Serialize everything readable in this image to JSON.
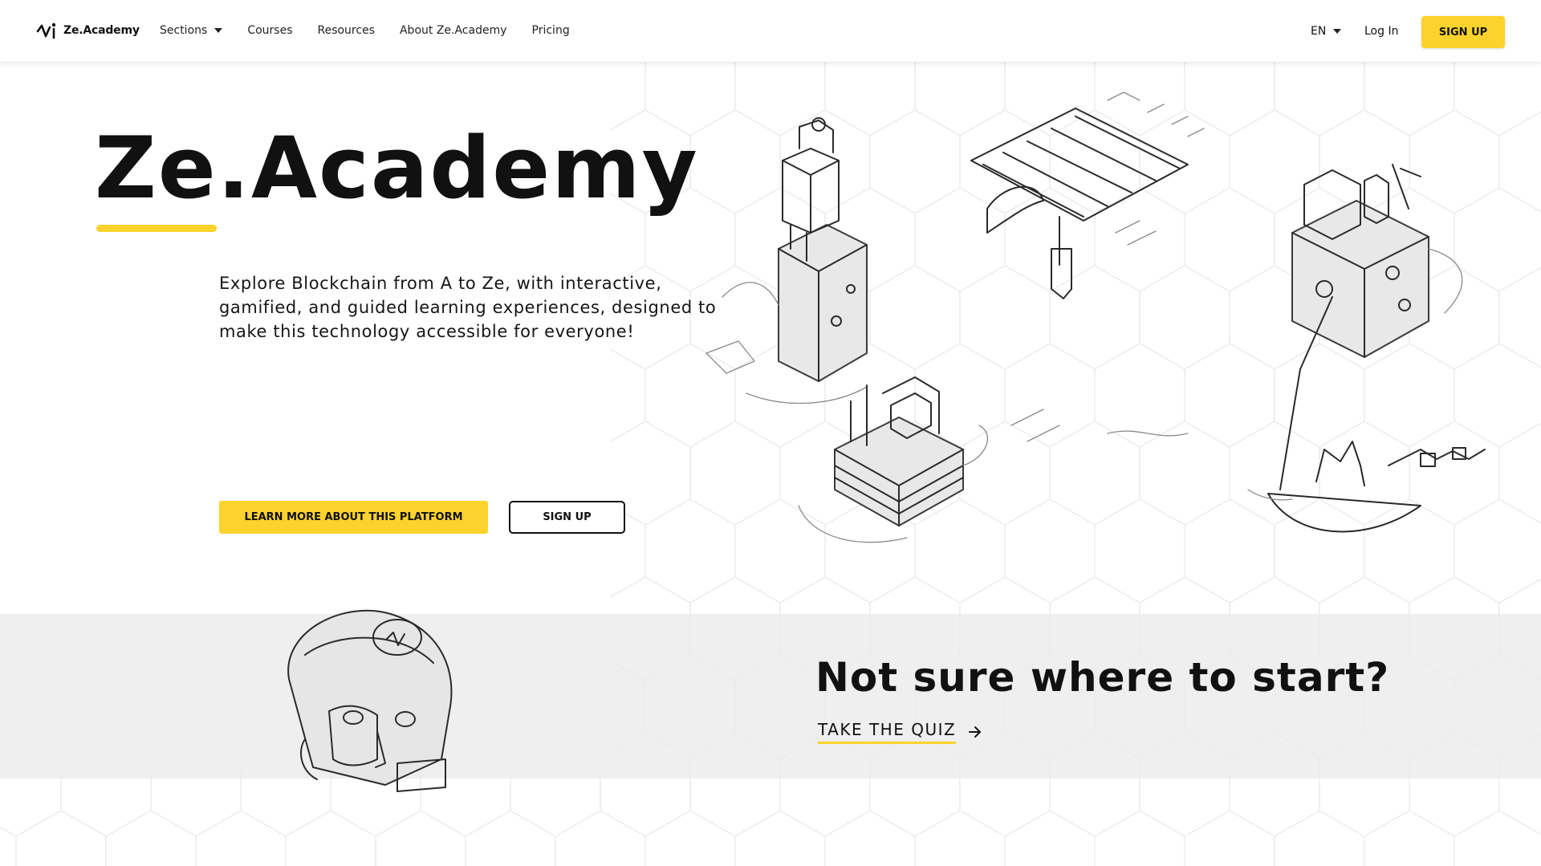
{
  "brand": {
    "name": "Ze.Academy",
    "accent_color": "#fcd22c",
    "logo_icon": "ze-wave-logo"
  },
  "nav": {
    "items": [
      {
        "label": "Sections",
        "has_dropdown": true
      },
      {
        "label": "Courses"
      },
      {
        "label": "Resources"
      },
      {
        "label": "About Ze.Academy"
      },
      {
        "label": "Pricing"
      }
    ],
    "language": "EN",
    "login": "Log In",
    "signup": "SIGN UP"
  },
  "hero": {
    "title": "Ze.Academy",
    "description": "Explore Blockchain from A to Ze, with interactive, gamified, and guided learning experiences, designed to make this technology accessible for everyone!",
    "primary_button": "LEARN MORE ABOUT THIS PLATFORM",
    "secondary_button": "SIGN UP"
  },
  "quiz": {
    "title": "Not sure where to start?",
    "link": "TAKE THE QUIZ",
    "link_icon": "arrow-right-icon"
  }
}
